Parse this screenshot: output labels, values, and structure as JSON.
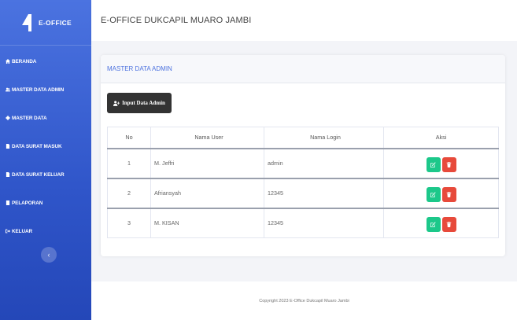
{
  "brand": {
    "name": "E-OFFICE"
  },
  "sidebar": {
    "items": [
      {
        "label": "BERANDA",
        "icon": "home-icon"
      },
      {
        "label": "MASTER DATA ADMIN",
        "icon": "users-icon"
      },
      {
        "label": "MASTER DATA",
        "icon": "gear-icon"
      },
      {
        "label": "DATA SURAT MASUK",
        "icon": "file-icon"
      },
      {
        "label": "DATA SURAT KELUAR",
        "icon": "file-icon"
      },
      {
        "label": "PELAPORAN",
        "icon": "book-icon"
      },
      {
        "label": "KELUAR",
        "icon": "sign-out-icon"
      }
    ],
    "toggle_glyph": "‹"
  },
  "topbar": {
    "title": "E-OFFICE DUKCAPIL MUARO JAMBI"
  },
  "card": {
    "title": "MASTER DATA ADMIN",
    "add_button_label": "Input Data Admin"
  },
  "table": {
    "headers": [
      "No",
      "Nama User",
      "Nama Login",
      "Aksi"
    ],
    "rows": [
      {
        "no": "1",
        "nama_user": "M. Jeffri",
        "nama_login": "admin"
      },
      {
        "no": "2",
        "nama_user": "Afriansyah",
        "nama_login": "12345"
      },
      {
        "no": "3",
        "nama_user": "M. KISAN",
        "nama_login": "12345"
      }
    ]
  },
  "footer": {
    "text": "Copyright 2023 E-Office Dukcapil Muaro Jambi"
  },
  "colors": {
    "sidebar": "#2f55c9",
    "accent": "#4e73df",
    "edit": "#1cc88a",
    "delete": "#e74a3b",
    "dark_button": "#333333"
  }
}
